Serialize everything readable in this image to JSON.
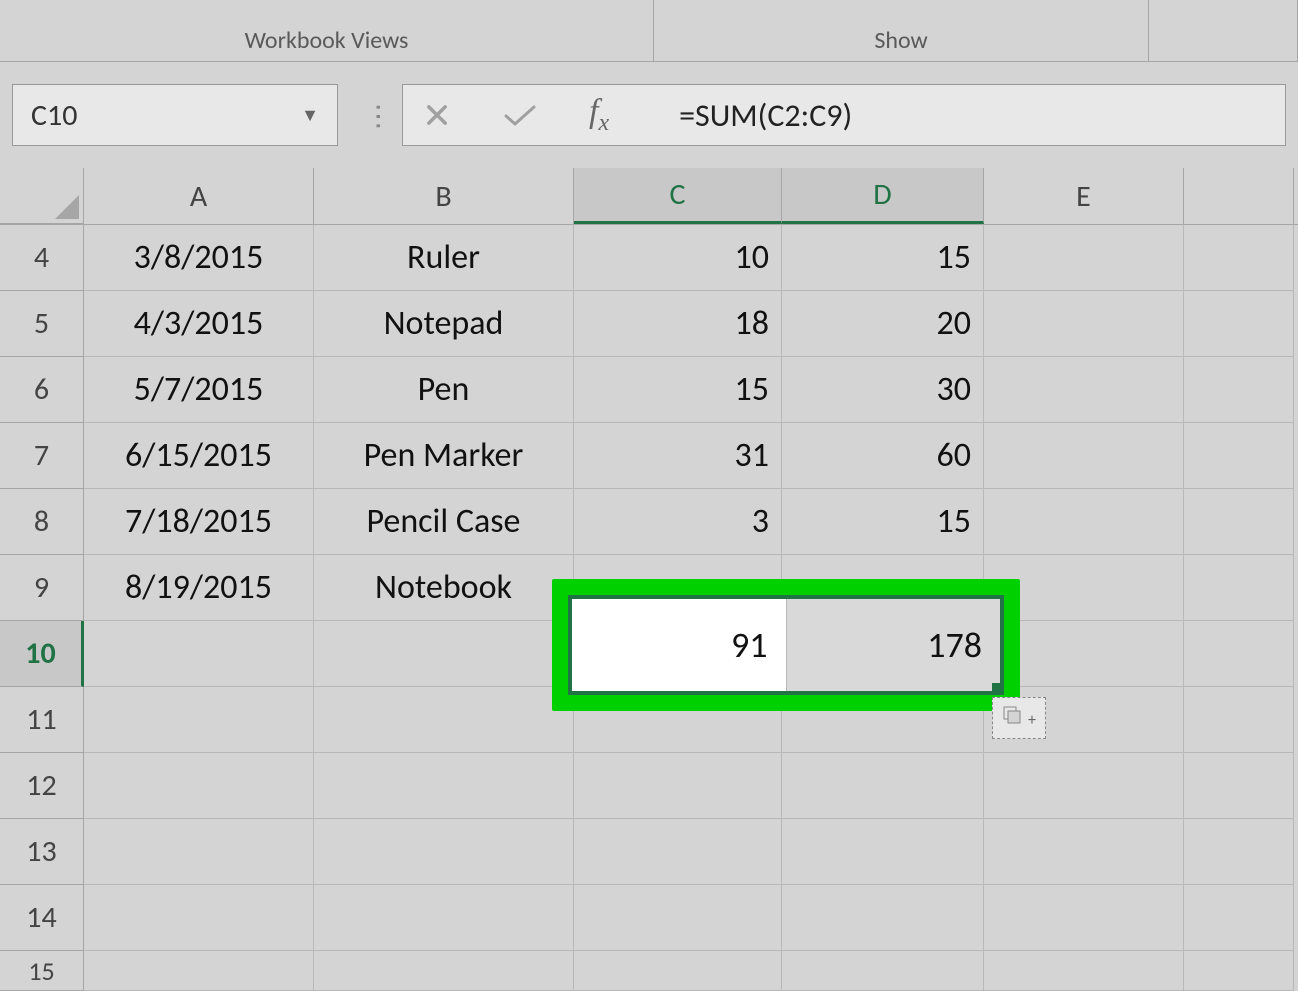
{
  "ribbon": {
    "group1": "Workbook Views",
    "group2": "Show"
  },
  "nameBox": {
    "value": "C10"
  },
  "formulaBar": {
    "value": "=SUM(C2:C9)"
  },
  "columns": [
    "A",
    "B",
    "C",
    "D",
    "E"
  ],
  "selectedColumns": [
    "C",
    "D"
  ],
  "rowHeaders": [
    "4",
    "5",
    "6",
    "7",
    "8",
    "9",
    "10",
    "11",
    "12",
    "13",
    "14",
    "15"
  ],
  "selectedRow": "10",
  "cells": {
    "r4": {
      "A": "3/8/2015",
      "B": "Ruler",
      "C": "10",
      "D": "15"
    },
    "r5": {
      "A": "4/3/2015",
      "B": "Notepad",
      "C": "18",
      "D": "20"
    },
    "r6": {
      "A": "5/7/2015",
      "B": "Pen",
      "C": "15",
      "D": "30"
    },
    "r7": {
      "A": "6/15/2015",
      "B": "Pen Marker",
      "C": "31",
      "D": "60"
    },
    "r8": {
      "A": "7/18/2015",
      "B": "Pencil Case",
      "C": "3",
      "D": "15"
    },
    "r9": {
      "A": "8/19/2015",
      "B": "Notebook",
      "C": "",
      "D": ""
    }
  },
  "highlight": {
    "C10": "91",
    "D10": "178"
  }
}
